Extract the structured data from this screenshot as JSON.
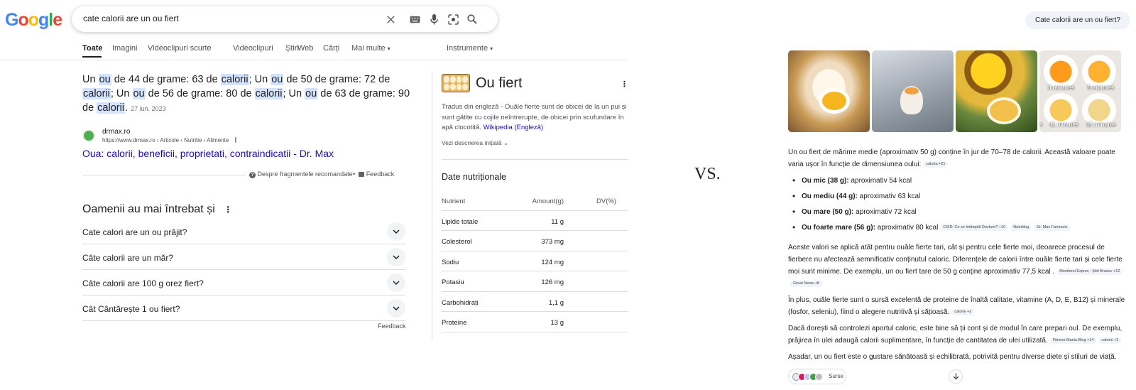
{
  "search": {
    "logo": [
      "G",
      "o",
      "o",
      "g",
      "l",
      "e"
    ],
    "query": "cate calorii are un ou fiert"
  },
  "tabs": [
    "Toate",
    "Imagini",
    "Videoclipuri scurte",
    "Videoclipuri",
    "Știri",
    "Web",
    "Cărți",
    "Mai multe",
    "Instrumente"
  ],
  "snippet": {
    "t1": "Un ",
    "h1": "ou",
    "t2": " de 44 de grame: 63 de ",
    "h2": "calorii",
    "t3": "; Un ",
    "h3": "ou",
    "t4": " de 50 de grame: 72 de ",
    "h4": "calorii",
    "t5": "; Un ",
    "h5": "ou",
    "t6": " de 56 de grame: 80 de ",
    "h6": "calorii",
    "t7": "; Un ",
    "h7": "ou",
    "t8": " de 63 de grame: 90 de ",
    "h8": "calorii",
    "t9": ".",
    "date": "27 iun. 2023",
    "source_name": "drmax.ro",
    "source_url": "https://www.drmax.ro › Articole › Nutritie › Alimente",
    "link": "Oua: calorii, beneficii, proprietati, contraindicatii - Dr. Max",
    "about": "Despre fragmentele recomandate",
    "feedback": "Feedback"
  },
  "paa": {
    "title": "Oamenii au mai întrebat și",
    "items": [
      "Cate calori are un ou prăjit?",
      "Câte calorii are un măr?",
      "Câte calorii are 100 g orez fiert?",
      "Cât Cântărește 1 ou fiert?"
    ],
    "feedback": "Feedback"
  },
  "knowledge": {
    "title": "Ou fiert",
    "desc": "Tradus din engleză - Ouăle fierte sunt de obicei de la un pui și sunt gătite cu cojile neîntrerupte, de obicei prin scufundare în apă clocotită.",
    "wiki": "Wikipedia (Engleză)",
    "more": "Vezi descrierea inițială",
    "nutrition_title": "Date nutriționale",
    "headers": [
      "Nutrient",
      "Amount(g)",
      "DV(%)"
    ],
    "rows": [
      {
        "n": "Lipide totale",
        "a": "11 g"
      },
      {
        "n": "Colesterol",
        "a": "373 mg"
      },
      {
        "n": "Sodiu",
        "a": "124 mg"
      },
      {
        "n": "Potasiu",
        "a": "126 mg"
      },
      {
        "n": "Carbohidrați",
        "a": "1,1 g"
      },
      {
        "n": "Proteine",
        "a": "13 g"
      }
    ]
  },
  "vs": "VS.",
  "ai": {
    "query": "Cate calorii are un ou fiert?",
    "image_captions": [
      "3 minutes",
      "5 minutes",
      "s",
      "11 minutes",
      "13 minutes"
    ],
    "intro": "Un ou fiert de mărime medie (aproximativ 50 g) conține în jur de 70–78 de calorii. Această valoare poate varia ușor în funcție de dimensiunea oului:",
    "intro_chip": "caloria +21",
    "bullets": [
      {
        "b": "Ou mic (38 g):",
        "t": " aproximativ 54 kcal"
      },
      {
        "b": "Ou mediu (44 g):",
        "t": " aproximativ 63 kcal"
      },
      {
        "b": "Ou mare (50 g):",
        "t": " aproximativ 72 kcal"
      },
      {
        "b": "Ou foarte mare (56 g):",
        "t": " aproximativ 80 kcal"
      }
    ],
    "bullet_chips": [
      "CSID: Ce se întâmplă Doctore? +10",
      "Nutriblog",
      "Dr. Max Farmacie"
    ],
    "p2": "Aceste valori se aplică atât pentru ouăle fierte tari, cât și pentru cele fierte moi, deoarece procesul de fierbere nu afectează semnificativ conținutul caloric. Diferențele de calorii între ouăle fierte tari și cele fierte moi sunt minime. De exemplu, un ou fiert tare de 50 g conține aproximativ 77,5 kcal .",
    "p2_chips": [
      "Monitorul Expres - Știri Brasov +12",
      "Great News +8"
    ],
    "p3": "În plus, ouăle fierte sunt o sursă excelentă de proteine de înaltă calitate, vitamine (A, D, E, B12) și minerale (fosfor, seleniu), fiind o alegere nutritivă și sățioasă.",
    "p3_chip": "calorie +2",
    "p4": "Dacă dorești să controlezi aportul caloric, este bine să ții cont și de modul în care prepari oul. De exemplu, prăjirea în ulei adaugă calorii suplimentare, în funcție de cantitatea de ulei utilizată.",
    "p4_chips": [
      "Fitness Mania Blog +14",
      "calorie +2"
    ],
    "p5": "Așadar, un ou fiert este o gustare sănătoasă și echilibrată, potrivită pentru diverse diete și stiluri de viață.",
    "sources_label": "Surse"
  },
  "colors": {
    "link": "#1a0dab",
    "highlight": "#d3e3fd",
    "logo": [
      "#4285f4",
      "#ea4335",
      "#fbbc05",
      "#4285f4",
      "#34a853",
      "#ea4335"
    ]
  }
}
